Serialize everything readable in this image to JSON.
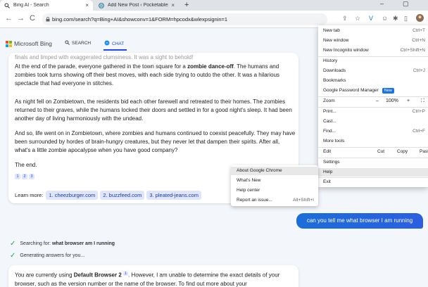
{
  "tabs": [
    {
      "title": "Bing AI - Search",
      "close": "×"
    },
    {
      "title": "Add New Post ‹ Pocketables — W",
      "close": "×"
    }
  ],
  "newtab_label": "+",
  "window": {
    "minimize": "–",
    "maximize": "▢"
  },
  "toolbar": {
    "back": "←",
    "forward": "→",
    "reload": "C",
    "url": "bing.com/search?q=Bing+AI&showconv=1&FORM=hpcodx&wlexpsignin=1"
  },
  "bing": {
    "brand": "Microsoft Bing",
    "search_label": "SEARCH",
    "chat_label": "CHAT",
    "logo_colors": [
      "#f25022",
      "#7fba00",
      "#00a4ef",
      "#ffb900"
    ],
    "accent": "#1b4aef"
  },
  "card": {
    "faded_line": "finals and limped with exaggerated clumsiness. It was a sight to behold!",
    "p1_before": "At the end of the parade, everyone gathered in the town square for a ",
    "p1_bold": "zombie dance-off",
    "p1_after": ". The humans and zombies took turns showing off their best moves, with each side trying to outdo the other. It was a hilarious spectacle that had everyone in stitches.",
    "p2": "As night fell on Zombietown, the residents bid each other farewell and retreated to their homes. The zombies returned to their graves, while the humans locked their doors and settled in for a good night's sleep. It had been another day of living harmoniously with the undead.",
    "p3": "And so, life went on in Zombietown, where zombies and humans continued to coexist peacefully. They may have been surrounded by hordes of brain-hungry creatures, but they never let that dampen their spirits. After all, what's a little zombie apocalypse when you have good company?",
    "p4": "The end.",
    "cites": [
      "1",
      "2",
      "3"
    ],
    "learn_more": "Learn more:",
    "links": [
      "1. cheezburger.com",
      "2. buzzfeed.com",
      "3. pleated-jeans.com"
    ]
  },
  "submenu": [
    {
      "label": "About Google Chrome",
      "shortcut": ""
    },
    {
      "label": "What's New",
      "shortcut": ""
    },
    {
      "label": "Help center",
      "shortcut": ""
    },
    {
      "label": "Report an issue...",
      "shortcut": "Alt+Shift+I"
    }
  ],
  "menu": {
    "new_tab": {
      "label": "New tab",
      "shortcut": "Ctrl+T"
    },
    "new_window": {
      "label": "New window",
      "shortcut": "Ctrl+N"
    },
    "incognito": {
      "label": "New Incognito window",
      "shortcut": "Ctrl+Shift+N"
    },
    "history": {
      "label": "History"
    },
    "downloads": {
      "label": "Downloads",
      "shortcut": "Ctrl+J"
    },
    "bookmarks": {
      "label": "Bookmarks"
    },
    "password": {
      "label": "Google Password Manager",
      "badge": "New"
    },
    "zoom": {
      "label": "Zoom",
      "minus": "–",
      "value": "100%",
      "plus": "+",
      "fullscreen": "⛶"
    },
    "print": {
      "label": "Print...",
      "shortcut": "Ctrl+P"
    },
    "cast": {
      "label": "Cast..."
    },
    "find": {
      "label": "Find...",
      "shortcut": "Ctrl+F"
    },
    "more_tools": {
      "label": "More tools"
    },
    "edit": {
      "label": "Edit",
      "cut": "Cut",
      "copy": "Copy",
      "paste": "Past"
    },
    "settings": {
      "label": "Settings"
    },
    "help": {
      "label": "Help"
    },
    "exit": {
      "label": "Exit"
    }
  },
  "user_message": "can you tell me what browser I am running",
  "progress": [
    {
      "prefix": "Searching for: ",
      "bold": "what browser am I running"
    },
    {
      "prefix": "Generating answers for you...",
      "bold": ""
    }
  ],
  "answer": {
    "before": "You are currently using ",
    "bold": "Default Browser 2",
    "cite": "1",
    "after": ". However, I am unable to determine the exact details of your browser, such as the version number or the name of the browser. To find out more about your"
  }
}
